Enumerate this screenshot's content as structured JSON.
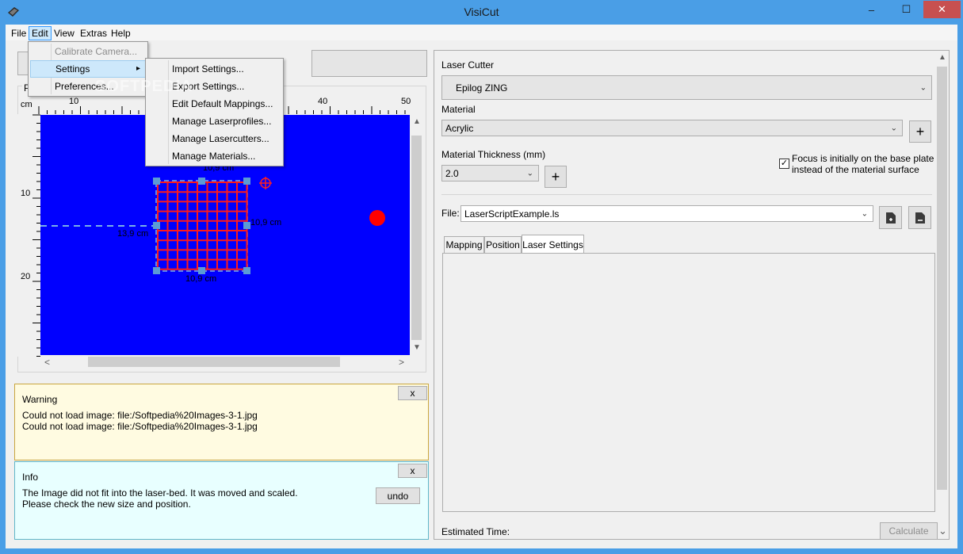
{
  "window": {
    "title": "VisiCut",
    "minimize": "–",
    "maximize": "☐",
    "close": "✕"
  },
  "menubar": [
    "File",
    "Edit",
    "View",
    "Extras",
    "Help"
  ],
  "edit_menu": {
    "items": [
      {
        "label": "Calibrate Camera...",
        "disabled": true
      },
      {
        "label": "Settings",
        "arrow": "▸"
      },
      {
        "label": "Preferences..."
      }
    ]
  },
  "settings_submenu": {
    "items": [
      "Import Settings...",
      "Export Settings...",
      "Edit Default Mappings...",
      "Manage Laserprofiles...",
      "Manage Lasercutters...",
      "Manage Materials..."
    ]
  },
  "watermark": "SOFTPEDIA",
  "ruler": {
    "unit": "cm",
    "top_labels": [
      "10",
      "40",
      "50"
    ],
    "left_labels": [
      "10",
      "20"
    ],
    "group_label": "P"
  },
  "preview": {
    "canvas_color": "#0000ff",
    "grid_color": "#ff0000",
    "handle_color": "#5b9bd5",
    "dims": {
      "top": "10,9 cm",
      "bottom": "10,9 cm",
      "right": "10,9 cm",
      "left": "13,9 cm"
    }
  },
  "scroll_arrows": {
    "up": "▲",
    "down": "▼",
    "left": "<",
    "right": ">",
    "rdown": "⌄"
  },
  "warning_panel": {
    "title": "Warning",
    "close": "x",
    "lines": [
      "Could not load image: file:/Softpedia%20Images-3-1.jpg",
      "Could not load image: file:/Softpedia%20Images-3-1.jpg"
    ]
  },
  "info_panel": {
    "title": "Info",
    "close": "x",
    "lines": [
      "The Image did not fit into the laser-bed. It was moved and scaled.",
      "Please check the new size and position."
    ],
    "undo": "undo"
  },
  "right": {
    "laser_cutter_label": "Laser Cutter",
    "laser_cutter_value": "Epilog ZING",
    "material_label": "Material",
    "material_value": "Acrylic",
    "thickness_label": "Material Thickness (mm)",
    "thickness_value": "2.0",
    "plus": "+",
    "focus_checked": "✓",
    "focus_line1": "Focus is initially on the base plate",
    "focus_line2": "instead of the material surface",
    "file_label": "File:",
    "file_value": "LaserScriptExample.ls",
    "tabs": [
      "Mapping",
      "Position",
      "Laser Settings"
    ],
    "estimated_time": "Estimated Time:",
    "calculate": "Calculate"
  }
}
